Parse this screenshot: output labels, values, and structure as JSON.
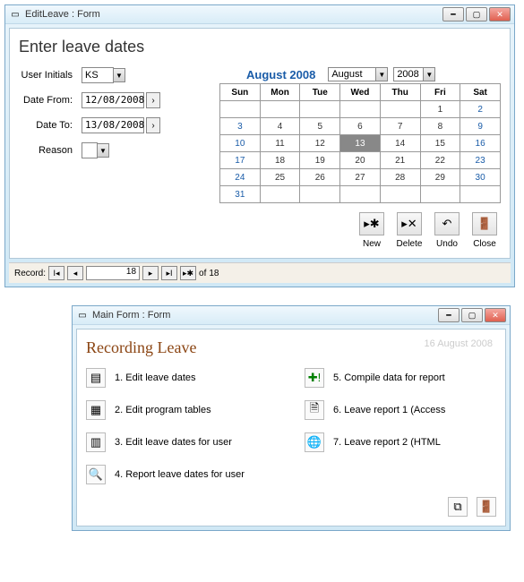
{
  "win1": {
    "title": "EditLeave : Form",
    "heading": "Enter leave dates",
    "labels": {
      "initials": "User Initials",
      "from": "Date From:",
      "to": "Date To:",
      "reason": "Reason"
    },
    "values": {
      "initials": "KS",
      "from": "12/08/2008",
      "to": "13/08/2008",
      "reason": ""
    },
    "cal": {
      "title": "August 2008",
      "month": "August",
      "year": "2008",
      "days": [
        "Sun",
        "Mon",
        "Tue",
        "Wed",
        "Thu",
        "Fri",
        "Sat"
      ],
      "weeks": [
        [
          "",
          "",
          "",
          "",
          "",
          "1",
          "2"
        ],
        [
          "3",
          "4",
          "5",
          "6",
          "7",
          "8",
          "9"
        ],
        [
          "10",
          "11",
          "12",
          "13",
          "14",
          "15",
          "16"
        ],
        [
          "17",
          "18",
          "19",
          "20",
          "21",
          "22",
          "23"
        ],
        [
          "24",
          "25",
          "26",
          "27",
          "28",
          "29",
          "30"
        ],
        [
          "31",
          "",
          "",
          "",
          "",
          "",
          ""
        ]
      ],
      "selected": "13"
    },
    "actions": {
      "new": "New",
      "delete": "Delete",
      "undo": "Undo",
      "close": "Close"
    },
    "recnav": {
      "label": "Record:",
      "current": "18",
      "total": "18",
      "of": "of"
    }
  },
  "win2": {
    "title": "Main Form : Form",
    "heading": "Recording Leave",
    "date": "16 August 2008",
    "items_left": [
      "1. Edit leave dates",
      "2. Edit program tables",
      "3. Edit leave dates for user",
      "4. Report leave dates for user"
    ],
    "items_right": [
      "5. Compile data for report",
      "6. Leave report 1 (Access",
      "7. Leave report 2 (HTML"
    ]
  }
}
